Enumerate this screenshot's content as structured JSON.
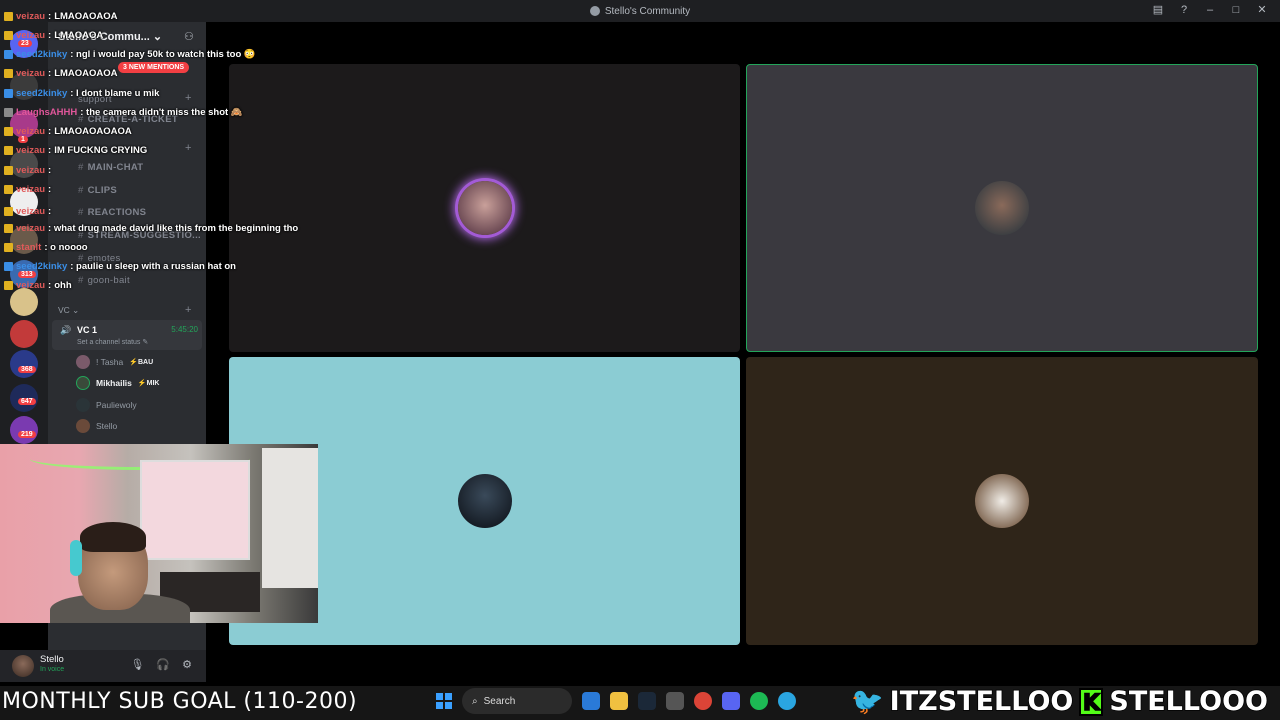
{
  "window": {
    "title": "Stello's Community"
  },
  "server": {
    "name": "Stello's Commu...",
    "mentions_badge": "3 NEW MENTIONS",
    "badges": [
      "23",
      "1",
      "313",
      "368",
      "647",
      "219"
    ]
  },
  "channels": [
    {
      "name": "support"
    },
    {
      "name": "CREATE-A-TICKET"
    },
    {
      "name": "MAIN-CHAT"
    },
    {
      "name": "CLIPS"
    },
    {
      "name": "REACTIONS"
    },
    {
      "name": "STREAM-SUGGESTIO..."
    },
    {
      "name": "emotes"
    },
    {
      "name": "goon-bait"
    }
  ],
  "voice": {
    "category": "VC",
    "channel_name": "VC 1",
    "timer": "5:45:20",
    "status_placeholder": "Set a channel status",
    "members": [
      {
        "name": "! Tasha",
        "tag": "⚡BAU"
      },
      {
        "name": "Mikhailis",
        "tag": "⚡MIK"
      },
      {
        "name": "Pauliewoly",
        "tag": ""
      },
      {
        "name": "Stello",
        "tag": ""
      }
    ]
  },
  "user_panel": {
    "name": "Stello",
    "status": "In voice"
  },
  "chat_overlay": [
    {
      "user": "veizau",
      "text": "LMAOAOAOA",
      "color": "#e05a5a"
    },
    {
      "user": "veizau",
      "text": "LMAOAOA",
      "color": "#e05a5a"
    },
    {
      "user": "seed2kinky",
      "text": ": ngl i would pay 50k to watch this too 😳",
      "color": "#3a8ee6"
    },
    {
      "user": "veizau",
      "text": "LMAOAOAOA",
      "color": "#e05a5a"
    },
    {
      "user": "seed2kinky",
      "text": ": I dont blame u mik",
      "color": "#3a8ee6"
    },
    {
      "user": "LaughsAHHH",
      "text": ": the camera didn't miss the shot 🙈",
      "color": "#e0569a"
    },
    {
      "user": "veizau",
      "text": "LMAOAOAOAOA",
      "color": "#e05a5a"
    },
    {
      "user": "veizau",
      "text": "IM FUCKNG CRYING",
      "color": "#e05a5a"
    },
    {
      "user": "veizau",
      "text": ":",
      "color": "#e05a5a"
    },
    {
      "user": "veizau",
      "text": ":",
      "color": "#e05a5a"
    },
    {
      "user": "veizau",
      "text": ":",
      "color": "#e05a5a"
    },
    {
      "user": "veizau",
      "text": ": what drug made david like this from the beginning tho",
      "color": "#e05a5a"
    },
    {
      "user": "stanlt",
      "text": ": o noooo",
      "color": "#e05a5a"
    },
    {
      "user": "seed2kinky",
      "text": ": paulie u sleep with a russian hat on",
      "color": "#3a8ee6"
    },
    {
      "user": "veizau",
      "text": "ohh",
      "color": "#e05a5a"
    }
  ],
  "overlay": {
    "sub_goal": "MONTHLY SUB GOAL (110-200)",
    "twitter_handle": "ITZSTELLOO",
    "kick_handle": "STELLOOO",
    "kick_letter": "K"
  },
  "taskbar": {
    "search_label": "Search"
  },
  "colors": {
    "discord_green": "#23a55a",
    "speaking_ring": "#a35bd6",
    "tile_cyan": "#8bccd3"
  }
}
